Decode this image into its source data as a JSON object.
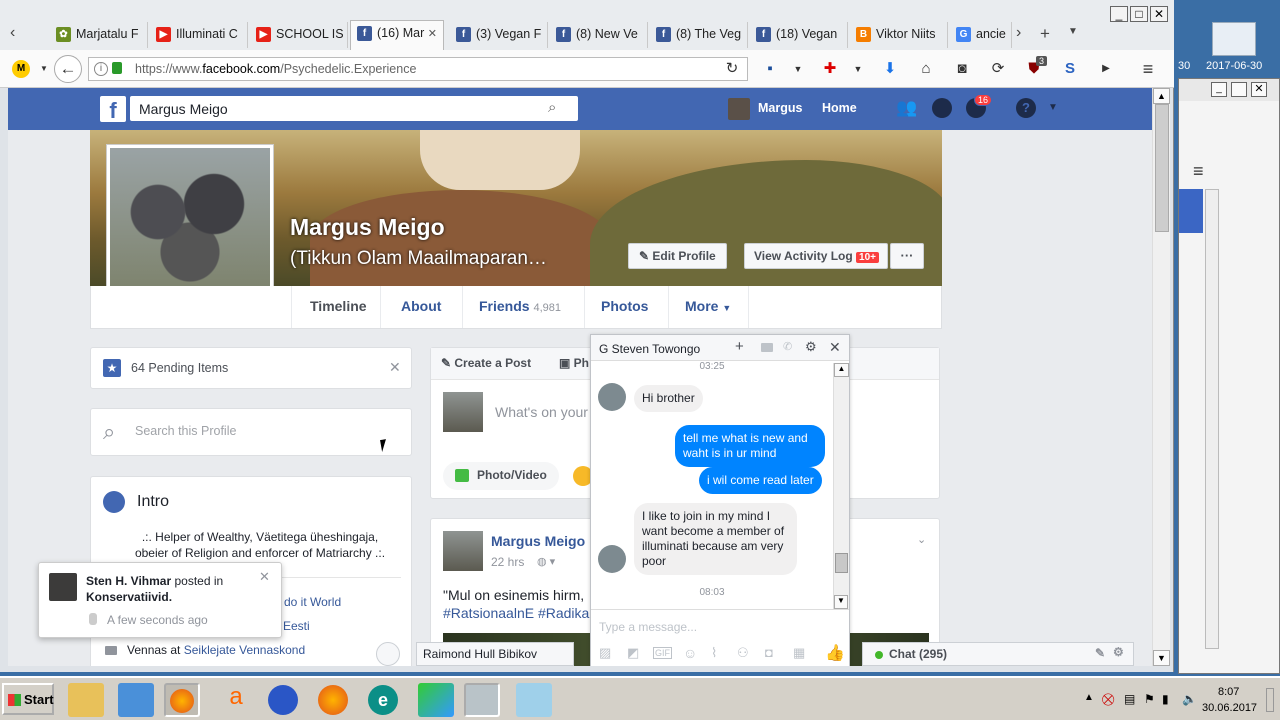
{
  "browser": {
    "tabs": [
      {
        "label": "Marjatalu F",
        "icon": "farm-icon",
        "color": "#6b8e23"
      },
      {
        "label": "Illuminati C",
        "icon": "youtube-icon",
        "color": "#e62117"
      },
      {
        "label": "SCHOOL IS",
        "icon": "youtube-icon",
        "color": "#e62117"
      },
      {
        "label": "(16) Mar",
        "icon": "facebook-icon",
        "color": "#3b5998"
      },
      {
        "label": "(3) Vegan F",
        "icon": "facebook-icon",
        "color": "#3b5998"
      },
      {
        "label": "(8) New Ve",
        "icon": "facebook-icon",
        "color": "#3b5998"
      },
      {
        "label": "(8) The Veg",
        "icon": "facebook-icon",
        "color": "#3b5998"
      },
      {
        "label": "(18) Vegan",
        "icon": "facebook-icon",
        "color": "#3b5998"
      },
      {
        "label": "Viktor Niits",
        "icon": "blogger-icon",
        "color": "#f57d00"
      },
      {
        "label": "ancie",
        "icon": "google-icon",
        "color": "#4285f4"
      }
    ],
    "url_prefix": "https://www.",
    "url_domain": "facebook.com",
    "url_path": "/Psychedelic.Experience",
    "ext_badge": "3"
  },
  "facebook": {
    "search_value": "Margus Meigo",
    "user_name": "Margus",
    "home_label": "Home",
    "notif_count": "16",
    "profile_name": "Margus Meigo",
    "profile_subtitle": "(Tikkun Olam Maailmaparan…",
    "edit_profile": "Edit Profile",
    "activity_log": "View Activity Log",
    "activity_badge": "10+",
    "more_dots": "···",
    "tabs": {
      "timeline": "Timeline",
      "about": "About",
      "friends": "Friends",
      "friends_count": "4,981",
      "photos": "Photos",
      "more": "More"
    },
    "pending": "64 Pending Items",
    "search_profile_placeholder": "Search this Profile",
    "intro_title": "Intro",
    "intro_text": ".:. Helper of Wealthy, Väetitega üheshingaja, obeier of Religion and enforcer of Matriarchy .:.",
    "intro_item1_tail": "Member at Let's do it World",
    "intro_item2_tail": "Eesti",
    "intro_item3_pre": "Vennas at",
    "intro_item3_link": "Seiklejate Vennaskond",
    "composer": {
      "create_post": "Create a Post",
      "photo_tab": "Ph",
      "placeholder": "What's on your",
      "photo_video": "Photo/Video"
    },
    "post": {
      "author": "Margus Meigo",
      "time": "22 hrs",
      "text_line1": "\"Mul on esinemis hirm,",
      "text_line2": "#RatsionaalnE #Radika"
    },
    "notification": {
      "actor": "Sten H. Vihmar",
      "action": "posted in",
      "group": "Konservatiivid.",
      "time": "A few seconds ago"
    },
    "chat_bar_name": "Raimond Hull Bibikov",
    "chat_label": "Chat (295)"
  },
  "messenger": {
    "title": "G Steven Towongo",
    "time1": "03:25",
    "msg1": "Hi brother",
    "msg2": "tell me what is new and waht is in ur mind",
    "msg3": "i wil come read later",
    "msg4": "I like to join in my mind I want become a member of illuminati because am very poor",
    "time2": "08:03",
    "input_placeholder": "Type a message..."
  },
  "system": {
    "start_label": "Start",
    "clock_time": "8:07",
    "clock_date": "30.06.2017",
    "bg_date": "2017-06-30",
    "bg_num": "30"
  }
}
